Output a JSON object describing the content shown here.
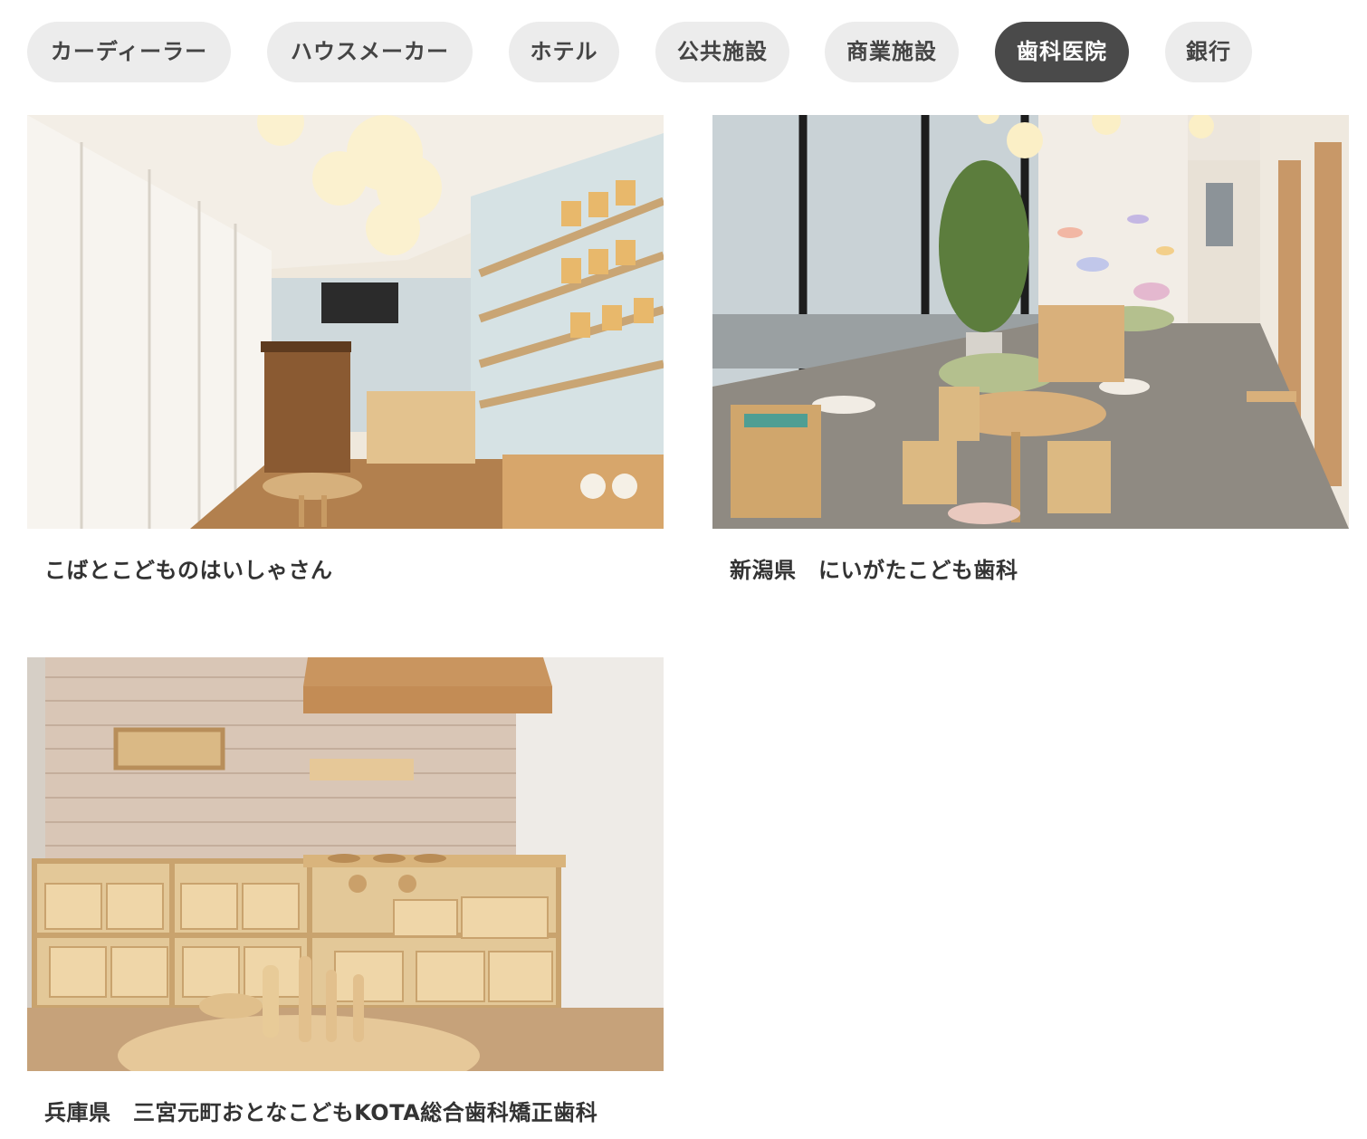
{
  "filter_tabs": [
    {
      "label": "カーディーラー",
      "active": false
    },
    {
      "label": "ハウスメーカー",
      "active": false
    },
    {
      "label": "ホテル",
      "active": false
    },
    {
      "label": "公共施設",
      "active": false
    },
    {
      "label": "商業施設",
      "active": false
    },
    {
      "label": "歯科医院",
      "active": true
    },
    {
      "label": "銀行",
      "active": false
    }
  ],
  "cases": [
    {
      "caption": "こばとこどものはいしゃさん",
      "image": "kids-corner-photo-bookshelf-wall"
    },
    {
      "caption": "新潟県　にいがたこども歯科",
      "image": "kids-play-area-photo-round-table"
    },
    {
      "caption": "兵庫県　三宮元町おとなこどもKOTA総合歯科矯正歯科",
      "image": "wooden-kitchen-shelf-photo"
    }
  ],
  "colors": {
    "tab_bg": "#ececec",
    "tab_active_bg": "#4a4a4a",
    "tab_text": "#444444",
    "tab_active_text": "#ffffff",
    "caption_text": "#333333"
  }
}
